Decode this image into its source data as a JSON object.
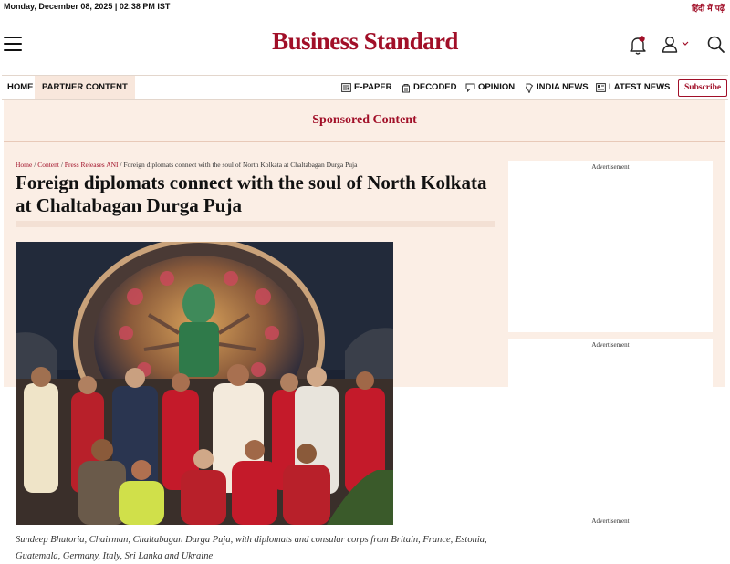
{
  "topbar": {
    "date": "Monday, December 08, 2025 | 02:38 PM IST",
    "hindi_link": "हिंदी में पढ़ें"
  },
  "header": {
    "logo": "Business Standard",
    "icons": [
      "hamburger-menu-icon",
      "bell-icon",
      "user-icon",
      "search-icon"
    ],
    "notification_dot_color": "#a10f28"
  },
  "nav": {
    "home": "HOME",
    "partner": "PARTNER CONTENT",
    "epaper": "E-PAPER",
    "decoded": "DECODED",
    "opinion": "OPINION",
    "india_news": "INDIA NEWS",
    "latest_news": "LATEST NEWS",
    "subscribe": "Subscribe"
  },
  "banner": {
    "text": "Sponsored Content"
  },
  "breadcrumb": {
    "items": [
      "Home",
      "Content",
      "Press Releases ANI"
    ],
    "current": "Foreign diplomats connect with the soul of North Kolkata at Chaltabagan Durga Puja",
    "separator": "/"
  },
  "article": {
    "headline": "Foreign diplomats connect with the soul of North Kolkata at Chaltabagan Durga Puja",
    "caption": "Sundeep Bhutoria, Chairman, Chaltabagan Durga Puja, with diplomats and consular corps from Britain, France, Estonia, Guatemala, Germany, Italy, Sri Lanka and Ukraine"
  },
  "ads": {
    "label": "Advertisement"
  },
  "colors": {
    "brand": "#a10f28",
    "panel_bg": "#fbeee5",
    "partner_tab_bg": "#f8e7dc"
  }
}
